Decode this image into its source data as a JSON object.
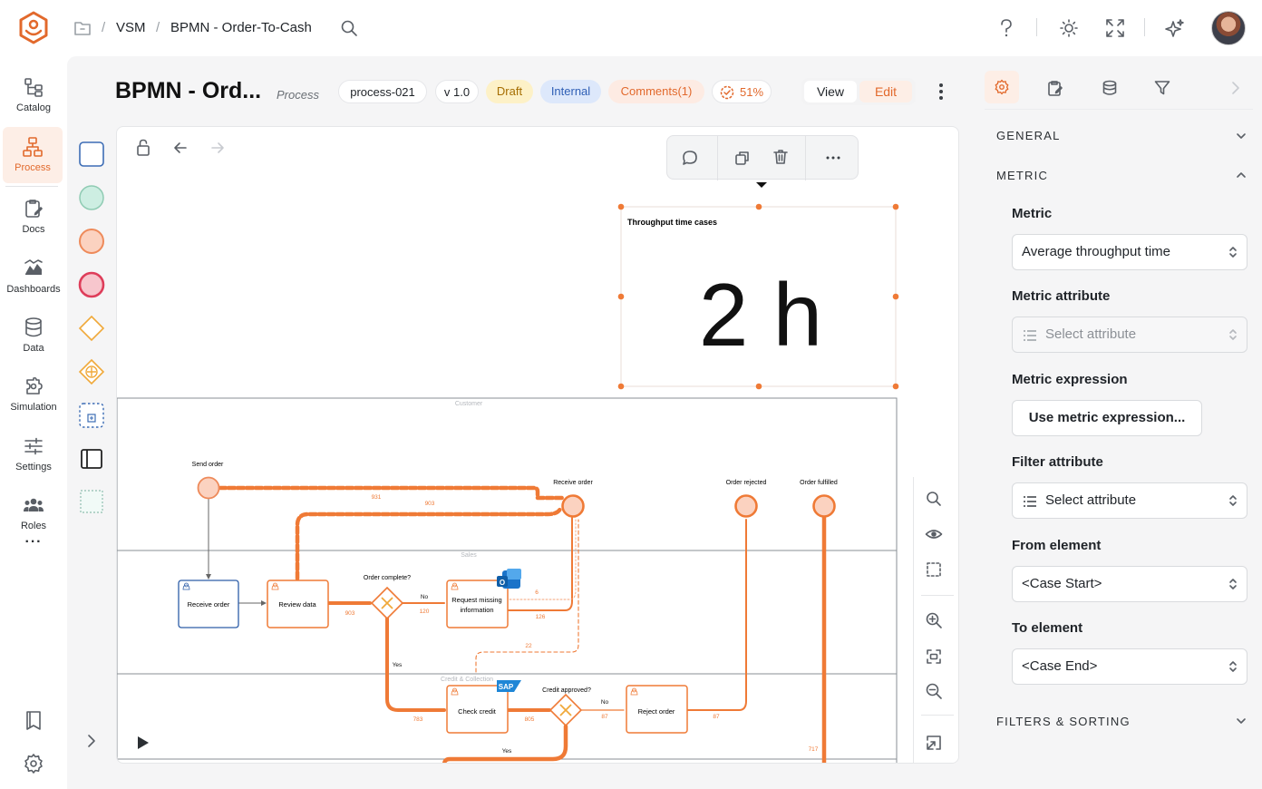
{
  "topbar": {
    "breadcrumb": [
      "VSM",
      "BPMN - Order-To-Cash"
    ],
    "separator": "/"
  },
  "leftnav": {
    "items": [
      {
        "label": "Catalog",
        "icon": "catalog-icon"
      },
      {
        "label": "Process",
        "icon": "process-icon",
        "active": true
      },
      {
        "label": "Docs",
        "icon": "docs-icon"
      },
      {
        "label": "Dashboards",
        "icon": "dashboards-icon"
      },
      {
        "label": "Data",
        "icon": "database-icon"
      },
      {
        "label": "Simulation",
        "icon": "simulation-icon"
      },
      {
        "label": "Settings",
        "icon": "settings-sliders-icon"
      },
      {
        "label": "Roles",
        "icon": "roles-icon"
      }
    ],
    "more": "···"
  },
  "header": {
    "title": "BPMN - Ord...",
    "type": "Process",
    "process_id": "process-021",
    "version": "v 1.0",
    "status": "Draft",
    "visibility": "Internal",
    "comments": "Comments(1)",
    "completion": "51%",
    "view_label": "View",
    "edit_label": "Edit"
  },
  "metric_widget": {
    "title": "Throughput time cases",
    "value": "2 h"
  },
  "diagram": {
    "lanes": [
      "Customer",
      "Sales",
      "Credit & Collection"
    ],
    "events": {
      "send_order": "Send order",
      "receive_order": "Receive order",
      "order_rejected": "Order rejected",
      "order_fulfilled": "Order fulfilled"
    },
    "tasks": {
      "receive_order": "Receive order",
      "review_data": "Review data",
      "request_missing_1": "Request missing",
      "request_missing_2": "information",
      "check_credit": "Check credit",
      "reject_order": "Reject order"
    },
    "gateways": {
      "order_complete": "Order complete?",
      "credit_approved": "Credit approved?"
    },
    "edge_labels": {
      "no": "No",
      "yes": "Yes",
      "n931": "931",
      "n903a": "903",
      "n903b": "903",
      "n120": "120",
      "n126": "126",
      "n6": "6",
      "n22": "22",
      "n783": "783",
      "n805": "805",
      "n87a": "87",
      "n87b": "87",
      "n717": "717"
    },
    "sap_label": "SAP"
  },
  "rightpanel": {
    "general": "GENERAL",
    "metric": "METRIC",
    "filters_sorting": "FILTERS & SORTING",
    "metric_label": "Metric",
    "metric_value": "Average throughput time",
    "metric_attr_label": "Metric attribute",
    "metric_attr_placeholder": "Select attribute",
    "metric_expr_label": "Metric expression",
    "metric_expr_button": "Use metric expression...",
    "filter_attr_label": "Filter attribute",
    "filter_attr_value": "Select attribute",
    "from_label": "From element",
    "from_value": "<Case Start>",
    "to_label": "To element",
    "to_value": "<Case End>"
  },
  "colors": {
    "accent": "#e2692c",
    "flow": "#ef7a36",
    "draft_bg": "#fdf1c7",
    "internal_bg": "#dde8fb",
    "comments_bg": "#fdebe3"
  }
}
